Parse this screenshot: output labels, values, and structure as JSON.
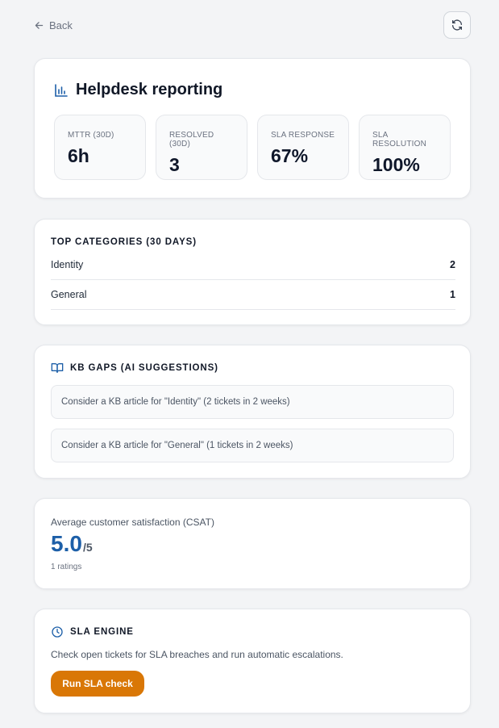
{
  "nav": {
    "back_label": "Back"
  },
  "colors": {
    "accent": "#1d5fa8",
    "button": "#d97706"
  },
  "reporting": {
    "title": "Helpdesk reporting",
    "metrics": [
      {
        "label": "MTTR (30D)",
        "value": "6h"
      },
      {
        "label": "RESOLVED (30D)",
        "value": "3"
      },
      {
        "label": "SLA RESPONSE",
        "value": "67%"
      },
      {
        "label": "SLA RESOLUTION",
        "value": "100%"
      }
    ]
  },
  "categories": {
    "title": "TOP CATEGORIES (30 DAYS)",
    "items": [
      {
        "name": "Identity",
        "count": "2"
      },
      {
        "name": "General",
        "count": "1"
      }
    ]
  },
  "kb": {
    "title": "KB GAPS (AI SUGGESTIONS)",
    "suggestions": [
      "Consider a KB article for \"Identity\" (2 tickets in 2 weeks)",
      "Consider a KB article for \"General\" (1 tickets in 2 weeks)"
    ]
  },
  "csat": {
    "label": "Average customer satisfaction (CSAT)",
    "value": "5.0",
    "max": "/5",
    "count": "1 ratings"
  },
  "sla": {
    "title": "SLA ENGINE",
    "description": "Check open tickets for SLA breaches and run automatic escalations.",
    "button_label": "Run SLA check"
  }
}
